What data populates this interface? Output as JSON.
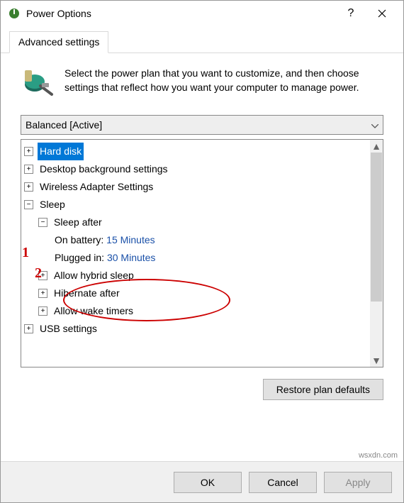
{
  "titlebar": {
    "title": "Power Options"
  },
  "tab": {
    "label": "Advanced settings"
  },
  "intro": {
    "text": "Select the power plan that you want to customize, and then choose settings that reflect how you want your computer to manage power."
  },
  "combo": {
    "selected": "Balanced [Active]"
  },
  "tree": {
    "hard_disk": "Hard disk",
    "desktop_bg": "Desktop background settings",
    "wireless": "Wireless Adapter Settings",
    "sleep": "Sleep",
    "sleep_after": "Sleep after",
    "on_battery_label": "On battery: ",
    "on_battery_value": "15 Minutes",
    "plugged_in_label": "Plugged in: ",
    "plugged_in_value": "30 Minutes",
    "hybrid": "Allow hybrid sleep",
    "hibernate": "Hibernate after",
    "wake_timers": "Allow wake timers",
    "usb": "USB settings"
  },
  "buttons": {
    "restore": "Restore plan defaults",
    "ok": "OK",
    "cancel": "Cancel",
    "apply": "Apply"
  },
  "annotations": {
    "one": "1",
    "two": "2"
  },
  "watermark": "wsxdn.com"
}
